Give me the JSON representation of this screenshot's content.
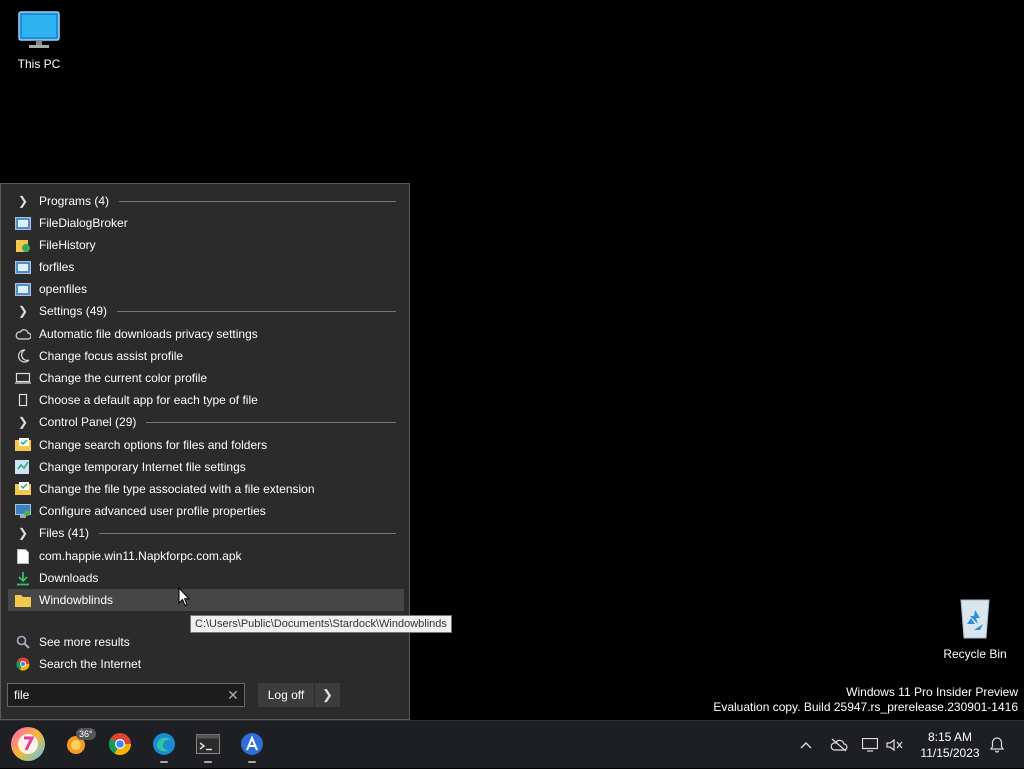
{
  "desktop": {
    "this_pc": "This PC",
    "recycle_bin": "Recycle Bin"
  },
  "start_menu": {
    "groups": {
      "programs": "Programs (4)",
      "settings": "Settings (49)",
      "control_panel": "Control Panel (29)",
      "files": "Files (41)"
    },
    "programs": [
      "FileDialogBroker",
      "FileHistory",
      "forfiles",
      "openfiles"
    ],
    "settings": [
      "Automatic file downloads privacy settings",
      "Change focus assist profile",
      "Change the current color profile",
      "Choose a default app for each type of file"
    ],
    "control_panel": [
      "Change search options for files and folders",
      "Change temporary Internet file settings",
      "Change the file type associated with a file extension",
      "Configure advanced user profile properties"
    ],
    "files": [
      "com.happie.win11.Napkforpc.com.apk",
      "Downloads",
      "Windowblinds"
    ],
    "see_more": "See more results",
    "search_internet": "Search the Internet",
    "search_value": "file",
    "log_off": "Log off",
    "tooltip": "C:\\Users\\Public\\Documents\\Stardock\\Windowblinds"
  },
  "watermark": {
    "line1": "Windows 11 Pro Insider Preview",
    "line2": "Evaluation copy. Build 25947.rs_prerelease.230901-1416"
  },
  "taskbar": {
    "weather_temp": "36°",
    "time": "8:15 AM",
    "date": "11/15/2023"
  }
}
